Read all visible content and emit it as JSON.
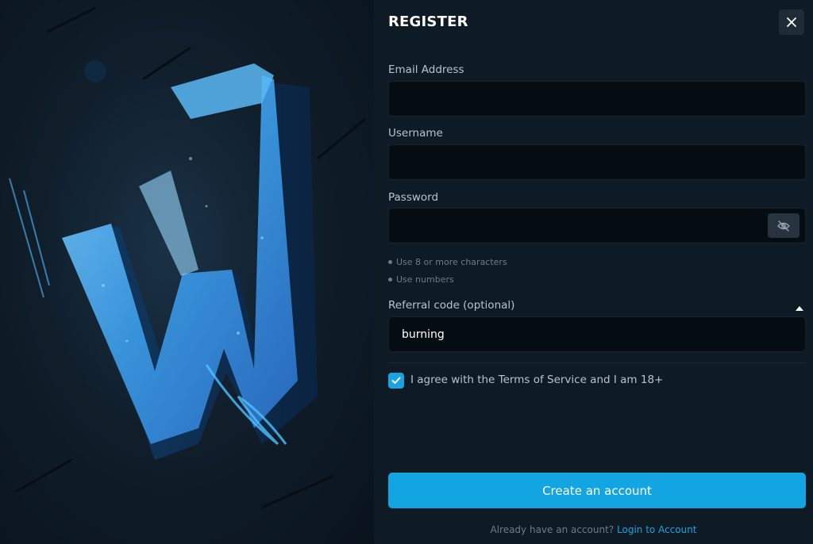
{
  "colors": {
    "accent": "#12a5e2",
    "panel_bg": "#0e1a24",
    "input_bg": "#050c12",
    "muted_text": "#6f7c88"
  },
  "hero": {
    "icon": "w-logo-art"
  },
  "register": {
    "title": "REGISTER",
    "close_icon": "close-icon",
    "email": {
      "label": "Email Address",
      "value": "",
      "placeholder": ""
    },
    "username": {
      "label": "Username",
      "value": "",
      "placeholder": ""
    },
    "password": {
      "label": "Password",
      "value": "",
      "placeholder": "",
      "toggle_icon": "eye-slash-icon",
      "hints": [
        "Use 8 or more characters",
        "Use numbers"
      ]
    },
    "referral": {
      "label": "Referral code (optional)",
      "value": "burning",
      "toggle_icon": "caret-up-icon"
    },
    "terms": {
      "label": "I agree with the Terms of Service and I am 18+",
      "checked": true
    },
    "submit_label": "Create an account",
    "footer": {
      "text": "Already have an account?",
      "link": "Login to Account"
    }
  }
}
